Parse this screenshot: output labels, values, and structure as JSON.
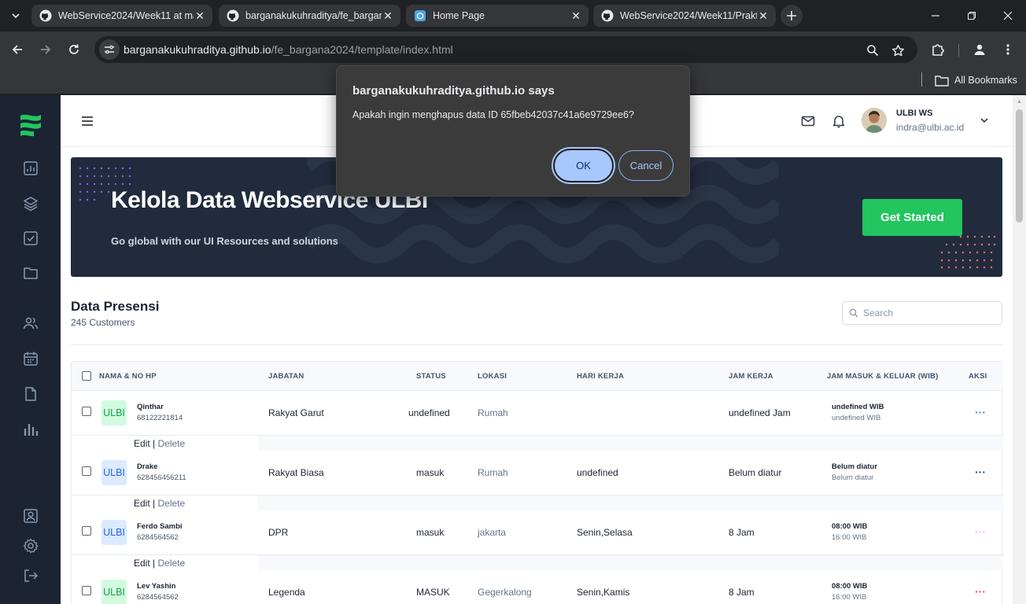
{
  "browser": {
    "tabs": [
      {
        "title": "WebService2024/Week11 at ma",
        "icon": "github-icon",
        "active": false
      },
      {
        "title": "barganakukuhraditya/fe_bargan",
        "icon": "github-icon",
        "active": false
      },
      {
        "title": "Home Page",
        "icon": "page-icon",
        "active": true
      },
      {
        "title": "WebService2024/Week11/Prakt",
        "icon": "github-icon",
        "active": false
      }
    ],
    "close_glyph": "✕",
    "url_host": "barganakukuhraditya.github.io",
    "url_path": "/fe_bargana2024/template/index.html",
    "bookmarks_label": "All Bookmarks"
  },
  "header": {
    "user_name": "ULBI WS",
    "user_email": "indra@ulbi.ac.id"
  },
  "hero": {
    "title": "Kelola Data Webservice ULBI",
    "subtitle": "Go global with our UI Resources and solutions",
    "cta_label": "Get Started"
  },
  "section": {
    "title": "Data Presensi",
    "subtitle": "245 Customers",
    "search_placeholder": "Search"
  },
  "table": {
    "headers": [
      "NAMA & NO HP",
      "JABATAN",
      "STATUS",
      "LOKASI",
      "HARI KERJA",
      "JAM KERJA",
      "JAM MASUK & KELUAR (WIB)",
      "AKSI"
    ],
    "edit_label": "Edit",
    "sep_label": "|",
    "delete_label": "Delete",
    "more_glyph": "···",
    "rows": [
      {
        "badge": "ULBI",
        "name": "Qinthar",
        "phone": "68122221814",
        "jabatan": "Rakyat Garut",
        "status": "undefined",
        "lokasi": "Rumah",
        "hari": "",
        "jam_kerja": "undefined Jam",
        "masuk": "undefined WIB",
        "keluar": "undefined WIB"
      },
      {
        "badge": "ULBI",
        "name": "Drake",
        "phone": "628456456211",
        "jabatan": "Rakyat Biasa",
        "status": "masuk",
        "lokasi": "Rumah",
        "hari": "undefined",
        "jam_kerja": "Belum diatur",
        "masuk": "Belum diatur",
        "keluar": "Belum diatur"
      },
      {
        "badge": "ULBI",
        "name": "Ferdo Sambi",
        "phone": "6284564562",
        "jabatan": "DPR",
        "status": "masuk",
        "lokasi": "jakarta",
        "hari": "Senin,Selasa",
        "jam_kerja": "8 Jam",
        "masuk": "08:00 WIB",
        "keluar": "16:00 WIB"
      },
      {
        "badge": "ULBI",
        "name": "Lev Yashin",
        "phone": "6284564562",
        "jabatan": "Legenda",
        "status": "MASUK",
        "lokasi": "Gegerkalong",
        "hari": "Senin,Kamis",
        "jam_kerja": "8 Jam",
        "masuk": "08:00 WIB",
        "keluar": "16:00 WIB"
      }
    ]
  },
  "dialog": {
    "title": "barganakukuhraditya.github.io says",
    "message": "Apakah ingin menghapus data ID 65fbeb42037c41a6e9729ee6?",
    "ok_label": "OK",
    "cancel_label": "Cancel"
  },
  "colors": {
    "sidebar": "#1c2434",
    "accent_green": "#22c55e",
    "hero_bg": "#212b3d",
    "badge_green_bg": "#d1fadf",
    "badge_green_fg": "#16a34a",
    "badge_blue_bg": "#dbeafe",
    "badge_blue_fg": "#2563eb",
    "dialog_bg": "#3b3b3c",
    "ok_button": "#a8c7fa"
  }
}
